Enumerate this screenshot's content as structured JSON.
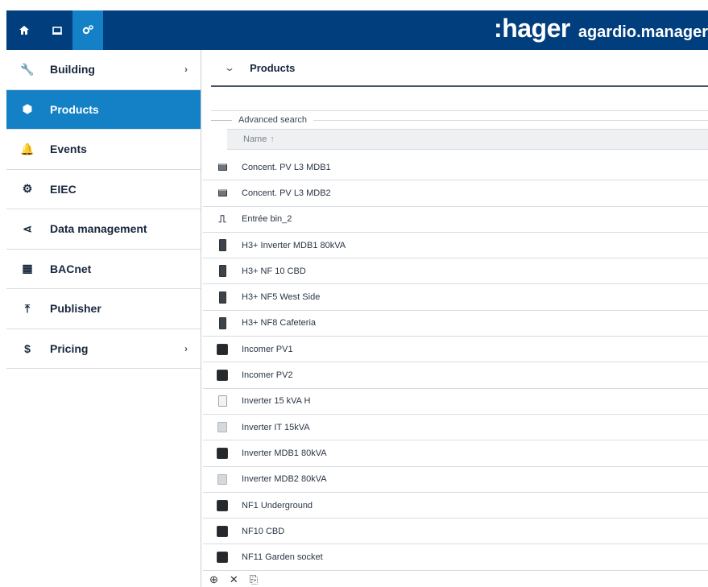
{
  "topbar": {
    "home_icon": "home-icon",
    "screen_icon": "screen-icon",
    "settings_icon": "gears-icon",
    "brand_logo": ":hager",
    "brand_app": "agardio.manager"
  },
  "sidebar": {
    "items": [
      {
        "label": "Building",
        "icon": "wrench-icon",
        "glyph": "🔧",
        "chevron": "›"
      },
      {
        "label": "Products",
        "icon": "cube-icon",
        "glyph": "⬢",
        "active": true
      },
      {
        "label": "Events",
        "icon": "bell-icon",
        "glyph": "🔔"
      },
      {
        "label": "EIEC",
        "icon": "gears-icon",
        "glyph": "⚙"
      },
      {
        "label": "Data management",
        "icon": "share-icon",
        "glyph": "⋖"
      },
      {
        "label": "BACnet",
        "icon": "bacnet-icon",
        "glyph": "▦"
      },
      {
        "label": "Publisher",
        "icon": "upload-icon",
        "glyph": "⤒"
      },
      {
        "label": "Pricing",
        "icon": "dollar-icon",
        "glyph": "$",
        "chevron": "›"
      }
    ]
  },
  "main": {
    "section_title": "Products",
    "section_chevron": "⌄",
    "advanced_search": "Advanced search",
    "column_name": "Name",
    "sort_arrow": "↑",
    "rows": [
      {
        "name": "Concent. PV L3 MDB1",
        "icon": "small"
      },
      {
        "name": "Concent. PV L3 MDB2",
        "icon": "small"
      },
      {
        "name": "Entrée bin_2",
        "icon": "pulse"
      },
      {
        "name": "H3+ Inverter MDB1 80kVA",
        "icon": "tall"
      },
      {
        "name": "H3+ NF 10 CBD",
        "icon": "tall"
      },
      {
        "name": "H3+ NF5 West Side",
        "icon": "tall"
      },
      {
        "name": "H3+ NF8 Cafeteria",
        "icon": "tall"
      },
      {
        "name": "Incomer PV1",
        "icon": "dark"
      },
      {
        "name": "Incomer PV2",
        "icon": "dark"
      },
      {
        "name": "Inverter 15 kVA H",
        "icon": "outline"
      },
      {
        "name": "Inverter IT 15kVA",
        "icon": "light"
      },
      {
        "name": "Inverter MDB1 80kVA",
        "icon": "dark"
      },
      {
        "name": "Inverter MDB2 80kVA",
        "icon": "light"
      },
      {
        "name": "NF1 Underground",
        "icon": "dark"
      },
      {
        "name": "NF10 CBD",
        "icon": "dark"
      },
      {
        "name": "NF11 Garden socket",
        "icon": "dark"
      }
    ],
    "tools": [
      {
        "name": "add-icon",
        "glyph": "⊕"
      },
      {
        "name": "delete-icon",
        "glyph": "✕"
      },
      {
        "name": "copy-icon",
        "glyph": "⎘"
      }
    ]
  }
}
